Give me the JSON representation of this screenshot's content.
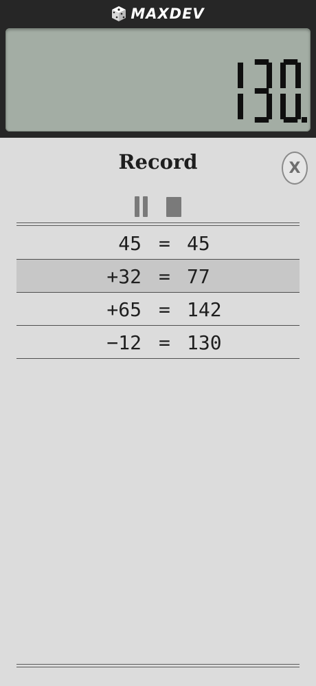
{
  "header": {
    "brand": "MAXDEV",
    "brand_icon": "dice-icon"
  },
  "display": {
    "value": "130."
  },
  "record": {
    "title": "Record",
    "close_label": "X",
    "rows": [
      {
        "expr": "45",
        "eq": "=",
        "result": "45"
      },
      {
        "expr": "+32",
        "eq": "=",
        "result": "77"
      },
      {
        "expr": "+65",
        "eq": "=",
        "result": "142"
      },
      {
        "expr": "−12",
        "eq": "=",
        "result": "130"
      }
    ]
  },
  "colors": {
    "lcd": "#a3ada4",
    "bezel": "#262626",
    "panel": "#dcdcdc",
    "highlight_row": "#c7c7c7"
  }
}
